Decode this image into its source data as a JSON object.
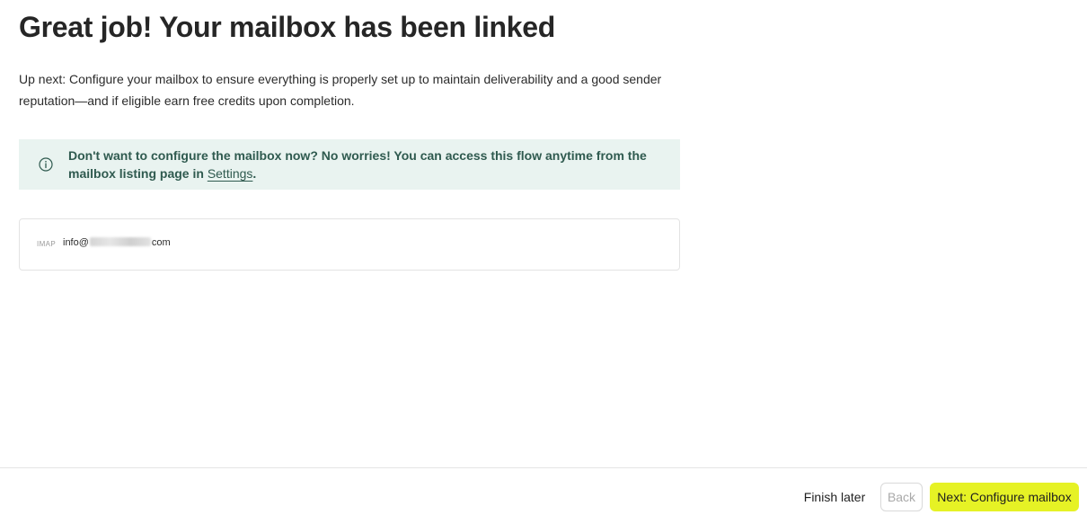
{
  "header": {
    "title": "Great job! Your mailbox has been linked"
  },
  "intro": {
    "text": "Up next: Configure your mailbox to ensure everything is properly set up to maintain deliverability and a good sender reputation—and if eligible earn free credits upon completion."
  },
  "notice": {
    "icon": "info-circle-icon",
    "text_before": "Don't want to configure the mailbox now? No worries! You can access this flow anytime from the mailbox listing page in ",
    "link_label": "Settings",
    "text_after": "."
  },
  "mailbox": {
    "type": "IMAP",
    "email_prefix": "info@",
    "email_suffix": "com"
  },
  "footer": {
    "finish_later_label": "Finish later",
    "back_label": "Back",
    "next_label": "Next: Configure mailbox"
  },
  "colors": {
    "notice_background": "#e9f3f0",
    "notice_text": "#2f5a4f",
    "primary_button": "#e6f225"
  }
}
